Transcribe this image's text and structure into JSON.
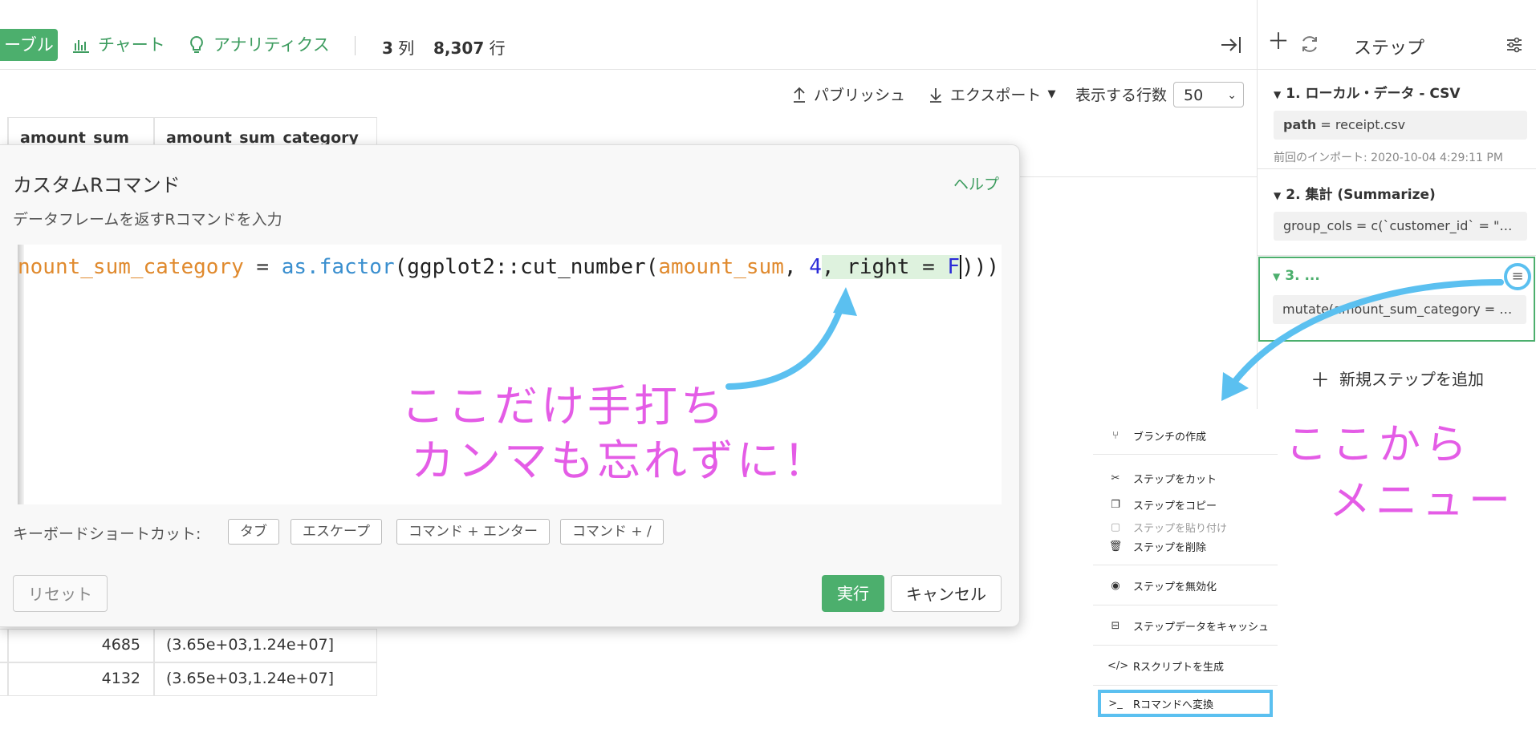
{
  "toolbar": {
    "tab_table": "ーブル",
    "tab_chart": "チャート",
    "tab_analytics": "アナリティクス",
    "cols_value": "3",
    "cols_unit": "列",
    "rows_value": "8,307",
    "rows_unit": "行"
  },
  "subbar": {
    "publish": "パブリッシュ",
    "export": "エクスポート",
    "rows_label": "表示する行数",
    "rows_select": "50"
  },
  "grid": {
    "columns": [
      "amount_sum",
      "amount_sum_category"
    ],
    "rows": [
      {
        "amount_sum": "4685",
        "category": "(3.65e+03,1.24e+07]"
      },
      {
        "amount_sum": "4132",
        "category": "(3.65e+03,1.24e+07]"
      }
    ]
  },
  "dialog": {
    "title": "カスタムRコマンド",
    "help": "ヘルプ",
    "subtitle": "データフレームを返すRコマンドを入力",
    "code": {
      "var": "nount_sum_category",
      "eq": " = ",
      "fn": "as.factor",
      "p1": "(",
      "call": "ggplot2::cut_number",
      "p2": "(",
      "arg": "amount_sum",
      "c1": ", ",
      "num": "4",
      "typed": ", right = ",
      "flag": "F",
      "close": ")))"
    },
    "shortcuts_label": "キーボードショートカット:",
    "shortcuts": [
      "タブ",
      "エスケープ",
      "コマンド + エンター",
      "コマンド + /"
    ],
    "reset": "リセット",
    "run": "実行",
    "cancel": "キャンセル"
  },
  "steps": {
    "header": "ステップ",
    "items": [
      {
        "title": "1. ローカル・データ - CSV",
        "param_key": "path",
        "param_rest": " = receipt.csv",
        "note": "前回のインポート: 2020-10-04 4:29:11 PM"
      },
      {
        "title": "2. 集計 (Summarize)",
        "param": "group_cols = c(`customer_id` = \"cu…"
      },
      {
        "title": "3. ...",
        "param": "mutate(amount_sum_category = as…"
      }
    ],
    "add_step": "新規ステップを追加"
  },
  "menu": {
    "items": [
      {
        "label": "ブランチの作成",
        "icon": "branch-icon"
      },
      {
        "label": "ステップをカット",
        "icon": "scissors-icon"
      },
      {
        "label": "ステップをコピー",
        "icon": "copy-icon"
      },
      {
        "label": "ステップを貼り付け",
        "icon": "clipboard-icon"
      },
      {
        "label": "ステップを削除",
        "icon": "trash-icon"
      },
      {
        "label": "ステップを無効化",
        "icon": "eye-off-icon"
      },
      {
        "label": "ステップデータをキャッシュ",
        "icon": "drive-icon"
      },
      {
        "label": "Rスクリプトを生成",
        "icon": "code-icon"
      },
      {
        "label": "Rコマンドへ変換",
        "icon": "terminal-icon"
      }
    ]
  },
  "annotations": {
    "typed_note_line1": "ここだけ手打ち",
    "typed_note_line2": "カンマも忘れずに！",
    "menu_note_line1": "ここから",
    "menu_note_line2": "メニュー"
  },
  "colors": {
    "accent_green": "#4caf6d",
    "annotation_blue": "#5bc0f0",
    "annotation_pink": "#e45ce6"
  }
}
